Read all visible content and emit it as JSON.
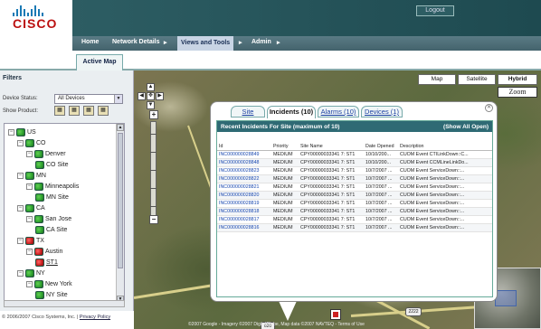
{
  "header": {
    "logo": "CISCO",
    "logout": "Logout"
  },
  "nav": {
    "items": [
      "Home",
      "Network Details",
      "Views and Tools",
      "Admin"
    ],
    "active": "Views and Tools"
  },
  "tab": {
    "active": "Active Map"
  },
  "filters": {
    "title": "Filters",
    "device_status_label": "Device Status:",
    "device_status_value": "All Devices",
    "show_product_label": "Show Product:",
    "products": [
      "product-icon-1",
      "product-icon-2",
      "product-icon-3",
      "product-icon-4"
    ],
    "tree": [
      {
        "label": "US",
        "level": 0,
        "icon": "green"
      },
      {
        "label": "CO",
        "level": 1,
        "icon": "green"
      },
      {
        "label": "Denver",
        "level": 2,
        "icon": "green"
      },
      {
        "label": "CO Site",
        "level": 3,
        "icon": "green"
      },
      {
        "label": "MN",
        "level": 1,
        "icon": "green"
      },
      {
        "label": "Minneapolis",
        "level": 2,
        "icon": "green"
      },
      {
        "label": "MN Site",
        "level": 3,
        "icon": "green"
      },
      {
        "label": "CA",
        "level": 1,
        "icon": "green"
      },
      {
        "label": "San Jose",
        "level": 2,
        "icon": "green"
      },
      {
        "label": "CA Site",
        "level": 3,
        "icon": "green"
      },
      {
        "label": "TX",
        "level": 1,
        "icon": "red"
      },
      {
        "label": "Austin",
        "level": 2,
        "icon": "red"
      },
      {
        "label": "ST1",
        "level": 3,
        "icon": "red"
      },
      {
        "label": "NY",
        "level": 1,
        "icon": "green"
      },
      {
        "label": "New York",
        "level": 2,
        "icon": "green"
      },
      {
        "label": "NY Site",
        "level": 3,
        "icon": "green"
      }
    ]
  },
  "footer": {
    "copyright": "© 2006/2007 Cisco Systems, Inc. |",
    "privacy": "Privacy Policy"
  },
  "map": {
    "buttons": [
      "Map",
      "Satellite",
      "Hybrid"
    ],
    "active_button": "Hybrid",
    "zoom_label": "Zoom",
    "credit": "©2007 Google - Imagery ©2007 DigitalGlobe, Map data ©2007 NAVTEQ - Terms of Use",
    "shields": [
      "620",
      "620",
      "2222"
    ]
  },
  "popup": {
    "tabs": [
      "Site",
      "Incidents (10)",
      "Alarms (10)",
      "Devices (1)"
    ],
    "active_tab": "Incidents (10)",
    "panel_title": "Recent Incidents For Site (maximum of 10)",
    "show_all": "(Show All Open)",
    "columns": [
      "Id",
      "Priority",
      "Site Name",
      "Date Opened",
      "Description"
    ],
    "rows": [
      [
        "INC000000028849",
        "MEDIUM",
        "CPY00000033341 7: ST1",
        "10/10/200...",
        "CUOM Event CTILinkDown::C..."
      ],
      [
        "INC000000028848",
        "MEDIUM",
        "CPY00000033341 7: ST1",
        "10/10/200...",
        "CUOM Event CCMLineLinkDo..."
      ],
      [
        "INC000000028823",
        "MEDIUM",
        "CPY00000033341 7: ST1",
        "10/7/2007 ...",
        "CUOM Event ServiceDown::..."
      ],
      [
        "INC000000028822",
        "MEDIUM",
        "CPY00000033341 7: ST1",
        "10/7/2007 ...",
        "CUOM Event ServiceDown::..."
      ],
      [
        "INC000000028821",
        "MEDIUM",
        "CPY00000033341 7: ST1",
        "10/7/2007 ...",
        "CUOM Event ServiceDown::..."
      ],
      [
        "INC000000028820",
        "MEDIUM",
        "CPY00000033341 7: ST1",
        "10/7/2007 ...",
        "CUOM Event ServiceDown::..."
      ],
      [
        "INC000000028819",
        "MEDIUM",
        "CPY00000033341 7: ST1",
        "10/7/2007 ...",
        "CUOM Event ServiceDown::..."
      ],
      [
        "INC000000028818",
        "MEDIUM",
        "CPY00000033341 7: ST1",
        "10/7/2007 ...",
        "CUOM Event ServiceDown::..."
      ],
      [
        "INC000000028817",
        "MEDIUM",
        "CPY00000033341 7: ST1",
        "10/7/2007 ...",
        "CUOM Event ServiceDown::..."
      ],
      [
        "INC000000028816",
        "MEDIUM",
        "CPY00000033341 7: ST1",
        "10/7/2007 ...",
        "CUOM Event ServiceDown::..."
      ]
    ]
  }
}
